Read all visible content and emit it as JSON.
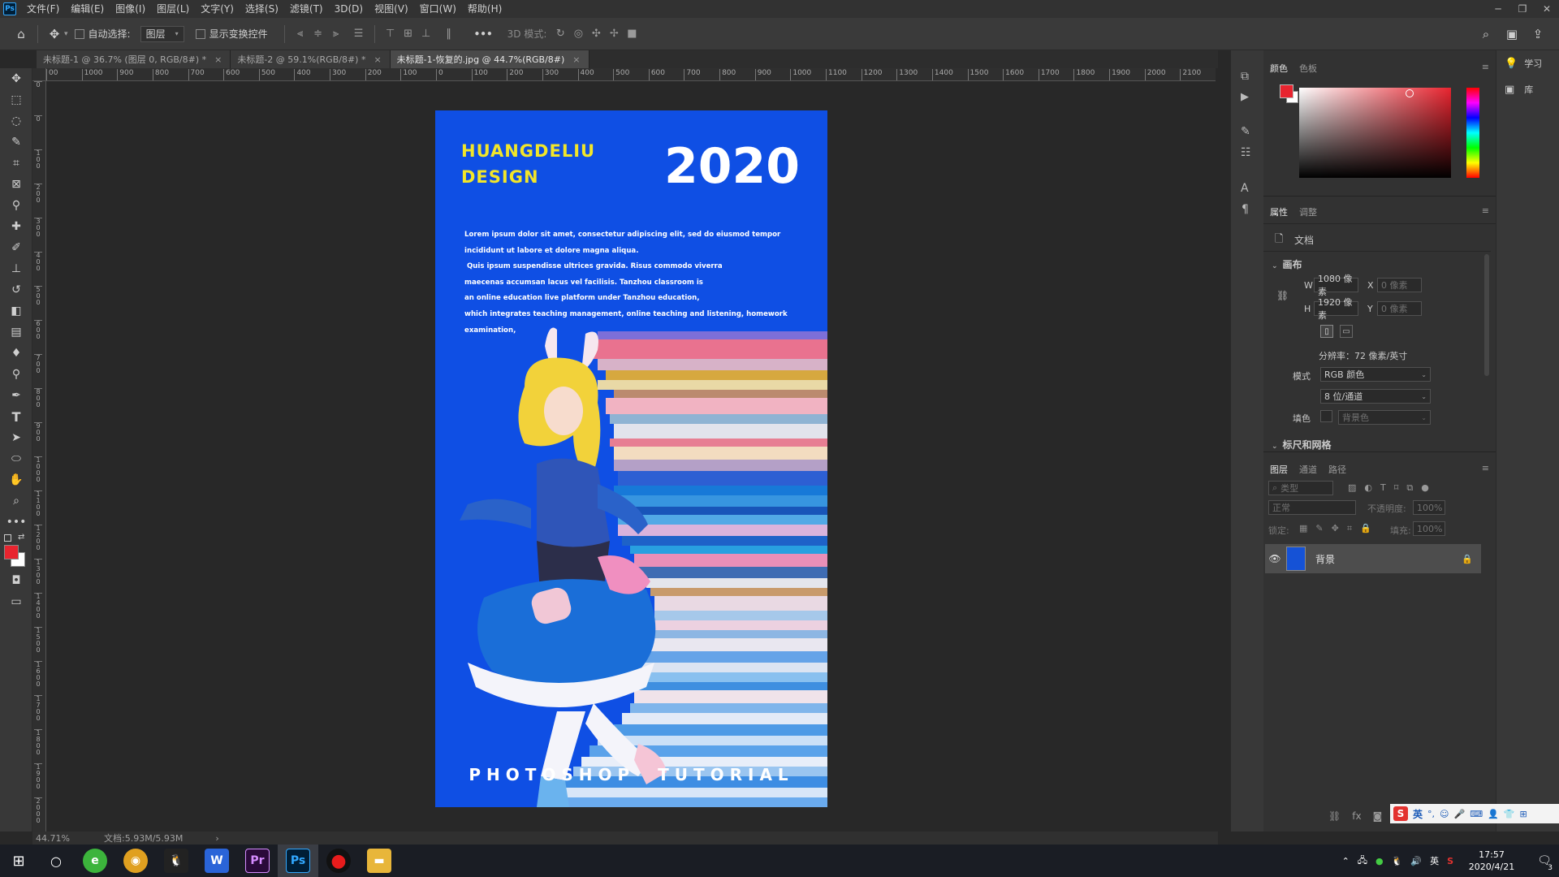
{
  "app": {
    "menu": [
      "文件(F)",
      "编辑(E)",
      "图像(I)",
      "图层(L)",
      "文字(Y)",
      "选择(S)",
      "滤镜(T)",
      "3D(D)",
      "视图(V)",
      "窗口(W)",
      "帮助(H)"
    ]
  },
  "options": {
    "auto_select_label": "自动选择:",
    "auto_select_value": "图层",
    "show_transform_label": "显示变换控件",
    "more": "•••",
    "mode_3d_label": "3D 模式:"
  },
  "tabs": [
    {
      "label": "未标题-1 @ 36.7% (图层 0, RGB/8#) *",
      "close": "×"
    },
    {
      "label": "未标题-2 @ 59.1%(RGB/8#) *",
      "close": "×"
    },
    {
      "label": "未标题-1-恢复的.jpg @ 44.7%(RGB/8#)",
      "close": "×"
    }
  ],
  "ruler": {
    "top_labels": [
      "00",
      "1000",
      "900",
      "800",
      "700",
      "600",
      "500",
      "400",
      "300",
      "200",
      "100",
      "0",
      "100",
      "200",
      "300",
      "400",
      "500",
      "600",
      "700",
      "800",
      "900",
      "1000",
      "1100",
      "1200",
      "1300",
      "1400",
      "1500",
      "1600",
      "1700",
      "1800",
      "1900",
      "2000",
      "2100"
    ],
    "left_labels": [
      "0",
      "0",
      "1 0 0",
      "2 0 0",
      "3 0 0",
      "4 0 0",
      "5 0 0",
      "6 0 0",
      "7 0 0",
      "8 0 0",
      "9 0 0",
      "1 0 0 0",
      "1 1 0 0",
      "1 2 0 0",
      "1 3 0 0",
      "1 4 0 0",
      "1 5 0 0",
      "1 6 0 0",
      "1 7 0 0",
      "1 8 0 0",
      "1 9 0 0",
      "2 0 0 0"
    ]
  },
  "poster": {
    "brand_line1": "HUANGDELIU",
    "brand_line2": "DESIGN",
    "year": "2020",
    "body_lines": [
      "Lorem ipsum dolor sit amet, consectetur adipiscing elit, sed do eiusmod tempor",
      "incididunt ut labore et dolore magna aliqua.",
      " Quis ipsum suspendisse ultrices gravida. Risus commodo viverra",
      "maecenas accumsan lacus vel facilisis. Tanzhou classroom is",
      "an online education live platform under Tanzhou education,",
      "which integrates teaching management, online teaching and listening, homework",
      "examination,"
    ],
    "footer": "PHOTOSHOP  TUTORIAL",
    "bg_color": "#0f4fe4",
    "brand_color": "#f2e629"
  },
  "status": {
    "zoom": "44.71%",
    "doc": "文档:5.93M/5.93M",
    "arrow": "›"
  },
  "color_panel": {
    "tab_color": "颜色",
    "tab_swatches": "色板",
    "fg_color": "#e8242f",
    "bg_color": "#ffffff"
  },
  "properties_panel": {
    "tab_properties": "属性",
    "tab_adjust": "调整",
    "doc_label": "文档",
    "canvas_section": "画布",
    "w_label": "W",
    "w_value": "1080 像素",
    "h_label": "H",
    "h_value": "1920 像素",
    "x_label": "X",
    "x_value": "0 像素",
    "y_label": "Y",
    "y_value": "0 像素",
    "resolution": "分辨率：72 像素/英寸",
    "mode_label": "模式",
    "mode_value": "RGB 颜色",
    "depth_value": "8 位/通道",
    "fill_label": "填色",
    "fill_value": "背景色",
    "rulers_section": "标尺和网格"
  },
  "layers_panel": {
    "tab_layers": "图层",
    "tab_channels": "通道",
    "tab_paths": "路径",
    "filter_placeholder": "类型",
    "blend_mode": "正常",
    "opacity_label": "不透明度:",
    "opacity_value": "100%",
    "lock_label": "锁定:",
    "fill_label": "填充:",
    "fill_value": "100%",
    "layer_name": "背景"
  },
  "far_right": {
    "learn": "学习",
    "library": "库"
  },
  "ime": {
    "lang": "英"
  },
  "taskbar": {
    "lang": "英",
    "time": "17:57",
    "date": "2020/4/21",
    "notif_count": "3",
    "apps": [
      {
        "name": "360",
        "color": "#3cb43c",
        "glyph": "e"
      },
      {
        "name": "chrome",
        "color": "#e0a020",
        "glyph": "◉"
      },
      {
        "name": "qq",
        "color": "#222",
        "glyph": "🐧"
      },
      {
        "name": "wps",
        "color": "#2a64d8",
        "glyph": "W"
      },
      {
        "name": "premiere",
        "color": "#2a0a3a",
        "glyph": "Pr"
      },
      {
        "name": "photoshop",
        "color": "#001e36",
        "glyph": "Ps"
      },
      {
        "name": "recorder",
        "color": "#111",
        "glyph": "●"
      },
      {
        "name": "explorer",
        "color": "#e8b63a",
        "glyph": "▬"
      }
    ]
  }
}
